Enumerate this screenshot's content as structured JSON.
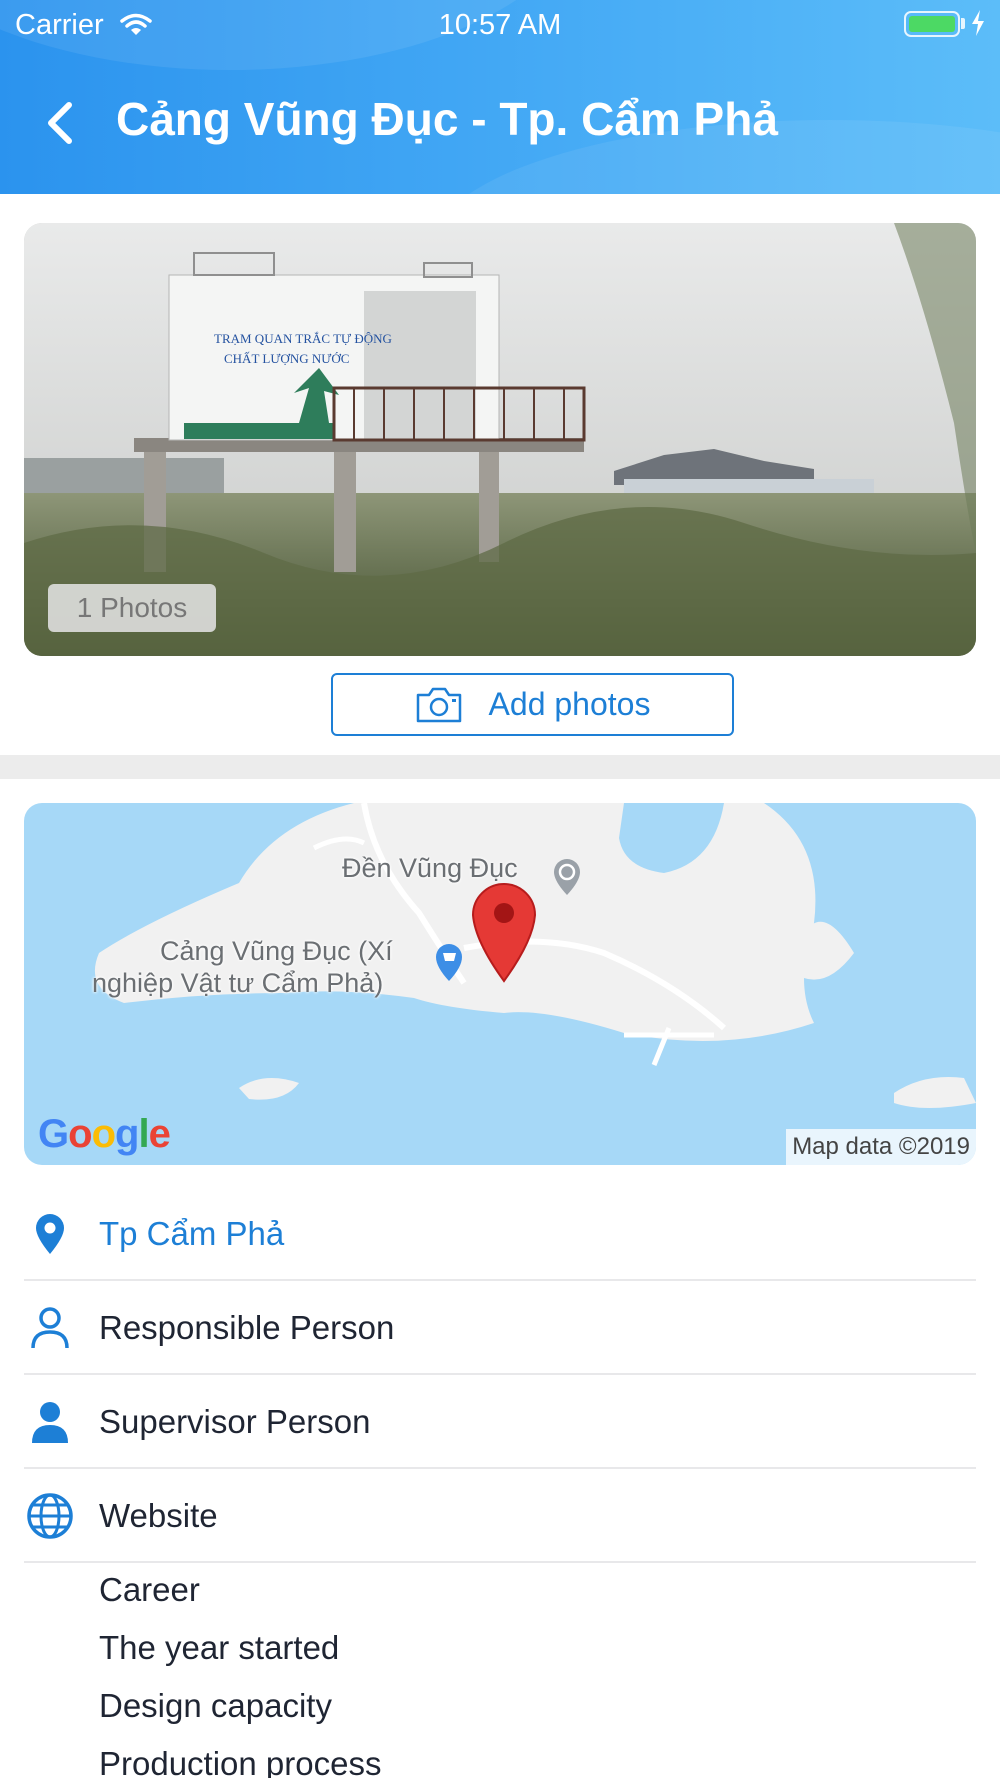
{
  "status_bar": {
    "carrier": "Carrier",
    "time": "10:57 AM"
  },
  "header": {
    "title": "Cảng Vũng Đục - Tp. Cẩm Phả"
  },
  "photo": {
    "count_label": "1 Photos",
    "sign_line1": "TRẠM QUAN TRẮC TỰ ĐỘNG",
    "sign_line2": "CHẤT LƯỢNG NƯỚC"
  },
  "add_photos": {
    "label": "Add photos"
  },
  "map": {
    "label_temple": "Đền Vũng Đục",
    "label_port_line1": "Cảng Vũng Đục (Xí",
    "label_port_line2": "nghiệp Vật tư Cẩm Phả)",
    "attribution": "Map data ©2019",
    "google_logo": "Google"
  },
  "info": {
    "location": "Tp Cẩm Phả",
    "responsible": "Responsible Person",
    "supervisor": "Supervisor Person",
    "website": "Website"
  },
  "details": [
    "Career",
    "The year started",
    "Design capacity",
    "Production process"
  ],
  "colors": {
    "accent": "#1d7fd6",
    "header_start": "#2b93ee",
    "header_end": "#5cbdf9",
    "pin": "#e53935"
  }
}
